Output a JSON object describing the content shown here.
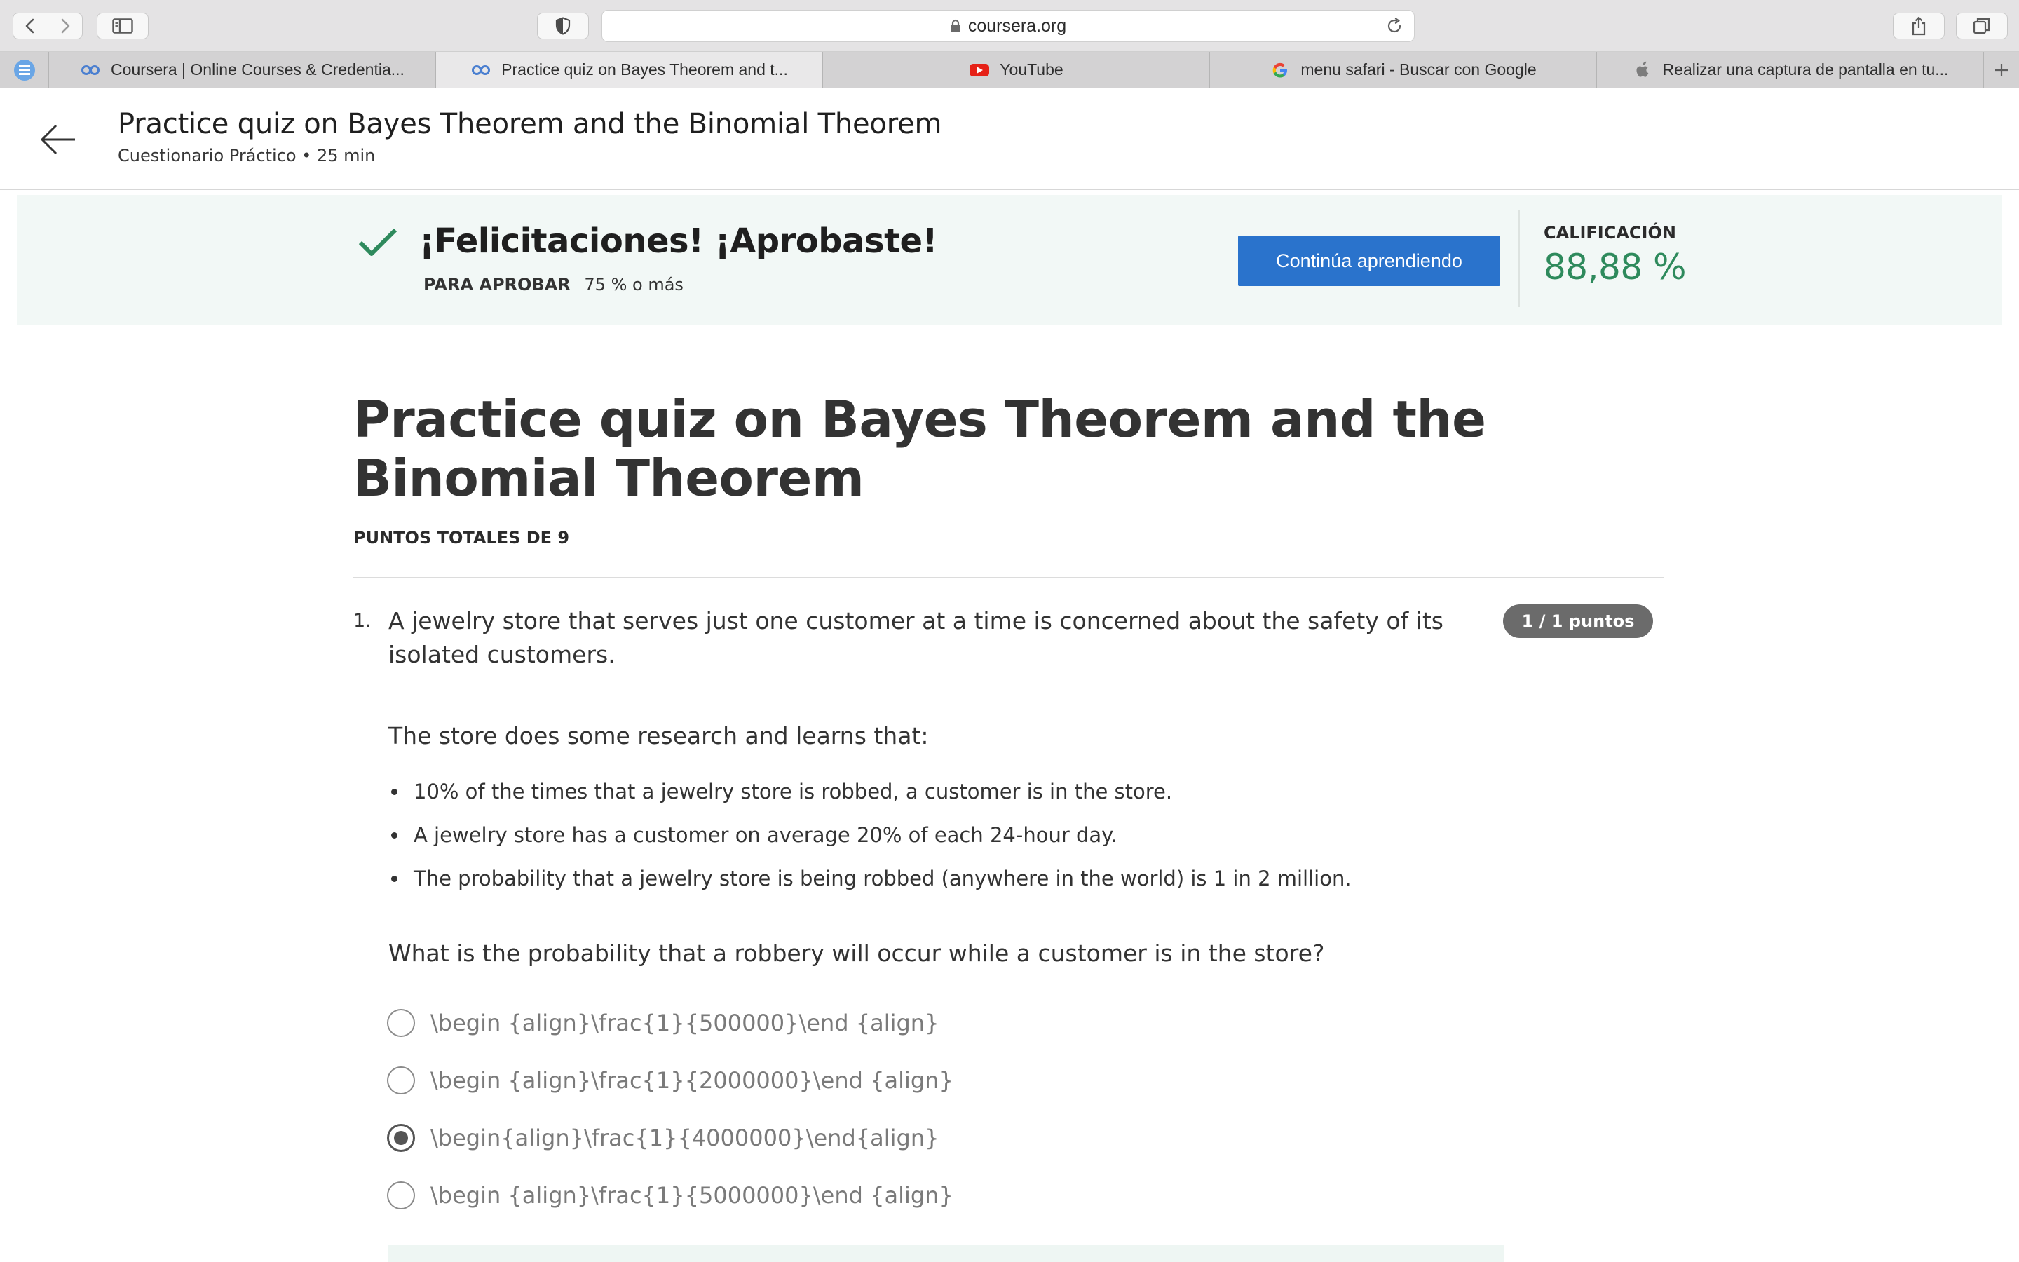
{
  "browser": {
    "url": "coursera.org",
    "tabs": [
      {
        "label": "Coursera | Online Courses & Credentia...",
        "active": false,
        "icon": "coursera-icon"
      },
      {
        "label": "Practice quiz on Bayes Theorem and t...",
        "active": true,
        "icon": "coursera-icon"
      },
      {
        "label": "YouTube",
        "active": false,
        "icon": "youtube-icon"
      },
      {
        "label": "menu safari - Buscar con Google",
        "active": false,
        "icon": "google-icon"
      },
      {
        "label": "Realizar una captura de pantalla en tu...",
        "active": false,
        "icon": "apple-icon"
      }
    ]
  },
  "header": {
    "title": "Practice quiz on Bayes Theorem and the Binomial Theorem",
    "subtitle": "Cuestionario Práctico • 25 min"
  },
  "result": {
    "message": "¡Felicitaciones! ¡Aprobaste!",
    "pass_label": "PARA APROBAR",
    "pass_value": "75 % o más",
    "continue_label": "Continúa aprendiendo",
    "grade_label": "CALIFICACIÓN",
    "grade_value": "88,88 %"
  },
  "quiz": {
    "title": "Practice quiz on Bayes Theorem and the Binomial Theorem",
    "points_total": "PUNTOS TOTALES DE 9"
  },
  "question": {
    "number": "1.",
    "text": "A jewelry store that serves just one customer at a time is concerned about the safety of its isolated customers.",
    "points_badge": "1 / 1 puntos",
    "intro": "The store does some research and learns that:",
    "bullets": [
      "10% of the times that a jewelry store is robbed, a customer is in the store.",
      "A jewelry store has a customer on average 20% of each 24-hour day.",
      "The probability that a jewelry store is being robbed (anywhere in the world) is 1 in 2 million."
    ],
    "prompt": "What is the probability that a robbery will occur while a customer is in the store?",
    "options": [
      {
        "label": "\\begin {align}\\frac{1}{500000}\\end {align}",
        "selected": false
      },
      {
        "label": "\\begin {align}\\frac{1}{2000000}\\end {align}",
        "selected": false
      },
      {
        "label": "\\begin{align}\\frac{1}{4000000}\\end{align}",
        "selected": true
      },
      {
        "label": "\\begin {align}\\frac{1}{5000000}\\end {align}",
        "selected": false
      }
    ]
  },
  "colors": {
    "accent_blue": "#2a73cc",
    "pass_green": "#2e8a5c",
    "banner_bg": "#f2f8f6"
  }
}
